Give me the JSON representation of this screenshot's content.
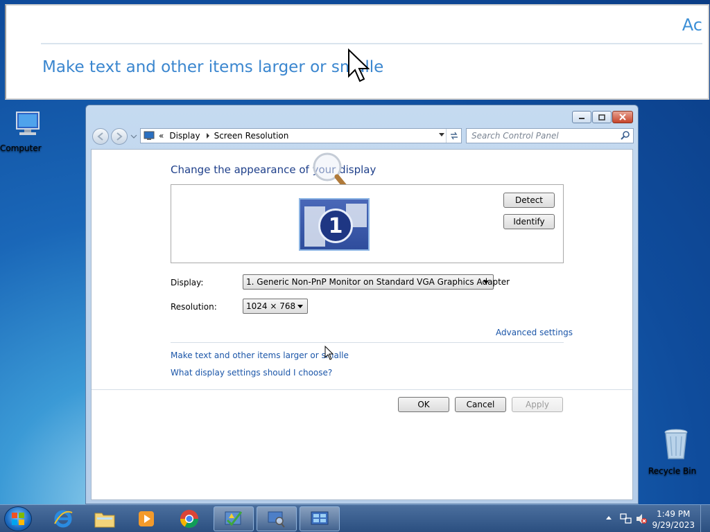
{
  "magnifier": {
    "partial_text": "Ac",
    "link_text": "Make text and other items larger or smalle"
  },
  "desktop": {
    "computer_label": "Computer",
    "recycle_label": "Recycle Bin"
  },
  "window": {
    "breadcrumb": {
      "chevrons": "«",
      "items": [
        "Display",
        "Screen Resolution"
      ]
    },
    "search_placeholder": "Search Control Panel",
    "heading": "Change the appearance of your display",
    "monitor_number": "1",
    "detect_label": "Detect",
    "identify_label": "Identify",
    "display_label": "Display:",
    "display_value": "1. Generic Non-PnP Monitor on Standard VGA Graphics Adapter",
    "resolution_label": "Resolution:",
    "resolution_value": "1024 × 768",
    "advanced_link": "Advanced settings",
    "text_size_link": "Make text and other items larger or smalle",
    "display_settings_link": "What display settings should I choose?",
    "ok_label": "OK",
    "cancel_label": "Cancel",
    "apply_label": "Apply"
  },
  "taskbar": {
    "time": "1:49 PM",
    "date": "9/29/2023",
    "pinned": [
      "internet-explorer",
      "file-explorer",
      "media-player",
      "chrome",
      "action-center",
      "display-control-panel",
      "screen-resolution"
    ]
  },
  "colors": {
    "link": "#1a55a8",
    "heading": "#1e3f8a",
    "taskbar": "#2b4f80"
  }
}
